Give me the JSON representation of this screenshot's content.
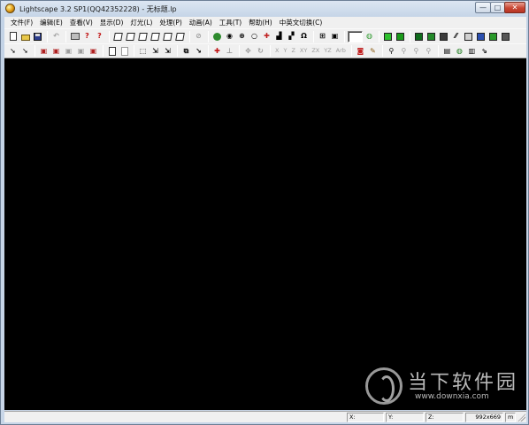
{
  "window": {
    "title": "Lightscape 3.2 SP1(QQ42352228)  - 无标题.lp",
    "minimize_glyph": "—",
    "maximize_glyph": "□",
    "close_glyph": "✕"
  },
  "menu": [
    "文件(F)",
    "编辑(E)",
    "查看(V)",
    "显示(D)",
    "灯光(L)",
    "处理(P)",
    "动画(A)",
    "工具(T)",
    "帮助(H)",
    "中英文切换(C)"
  ],
  "toolbar": {
    "help_glyph": "?",
    "context_help_glyph": "?",
    "axis_x": "X",
    "axis_y": "Y",
    "axis_z": "Z",
    "axis_xy": "XY",
    "axis_zx": "ZX",
    "axis_yz": "YZ",
    "axis_arb": "Arb"
  },
  "statusbar": {
    "x_label": "X:",
    "y_label": "Y:",
    "z_label": "Z:",
    "size": "992x669",
    "unit": "m"
  },
  "watermark": {
    "brand": "当下软件园",
    "url": "www.downxia.com"
  },
  "colors": {
    "viewport": "#000000",
    "frame": "#c8d6e8",
    "close_button": "#c94733"
  }
}
